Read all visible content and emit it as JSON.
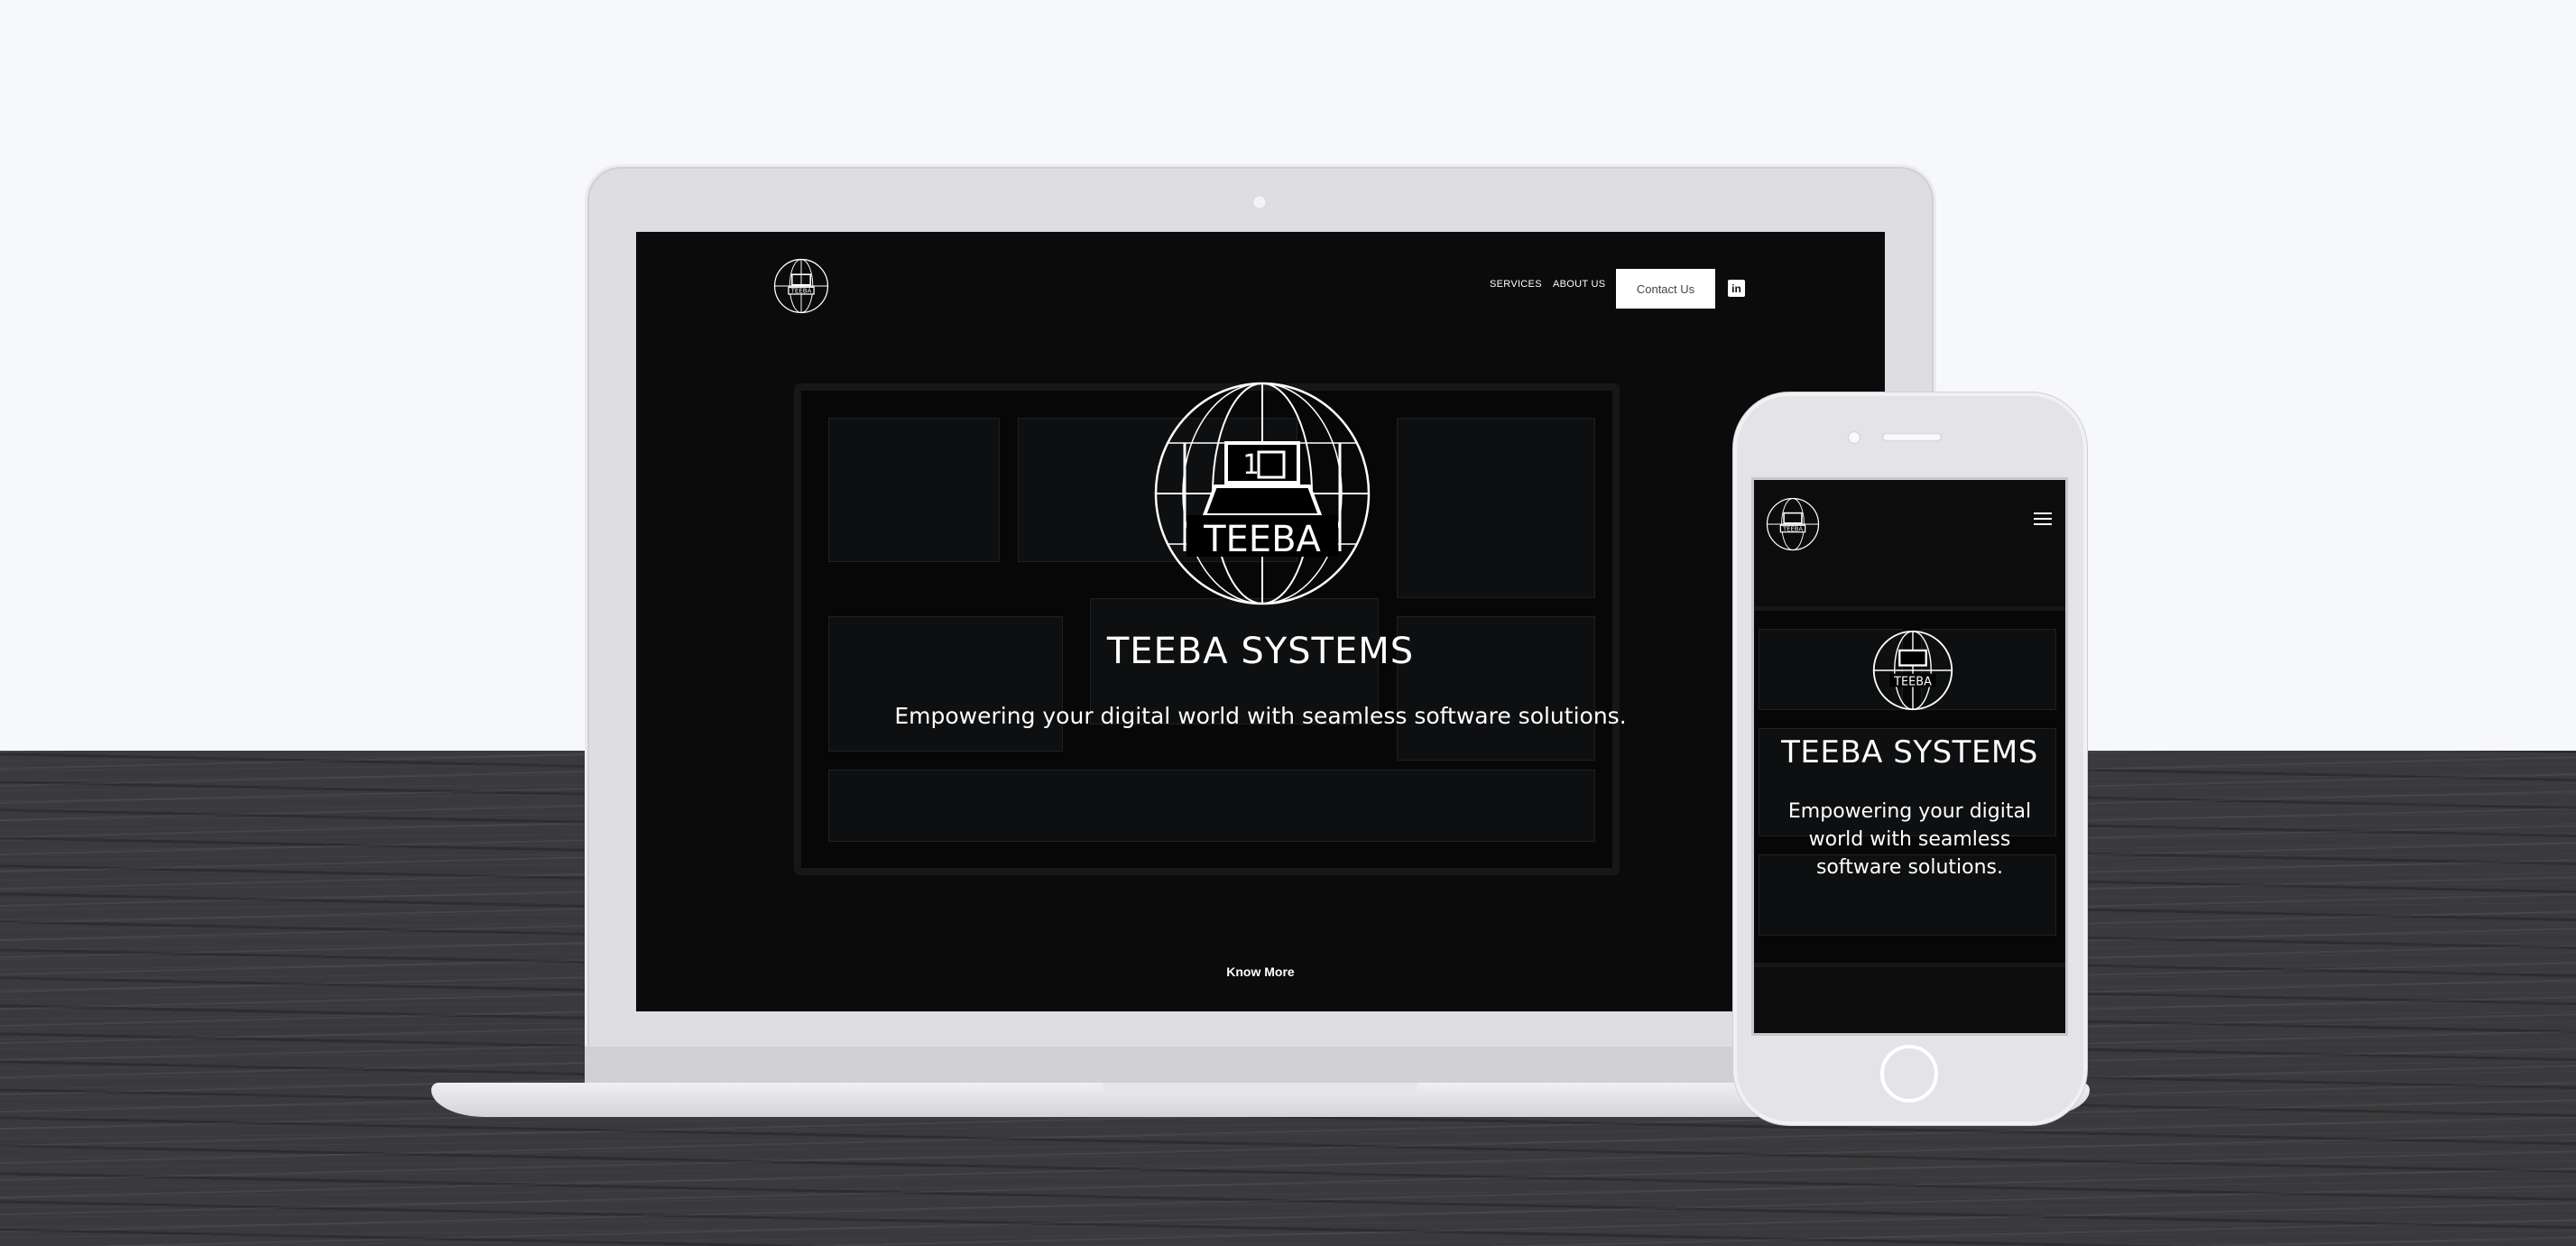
{
  "site": {
    "brand_logo_text": "TEEBA",
    "nav": {
      "services_label": "SERVICES",
      "about_label": "ABOUT US",
      "contact_label": "Contact Us",
      "linkedin_icon": "linkedin-icon",
      "linkedin_glyph": "in"
    },
    "hero": {
      "title": "TEEBA SYSTEMS",
      "subtitle": "Empowering your digital world with seamless software solutions.",
      "cta_label": "Know More"
    }
  },
  "mobile": {
    "menu_icon": "hamburger-menu-icon"
  },
  "colors": {
    "overlay": "#000000",
    "text": "#ffffff",
    "contact_button_bg": "#ffffff",
    "desk": "#3a3a3c",
    "wall": "#f7f8f9"
  }
}
